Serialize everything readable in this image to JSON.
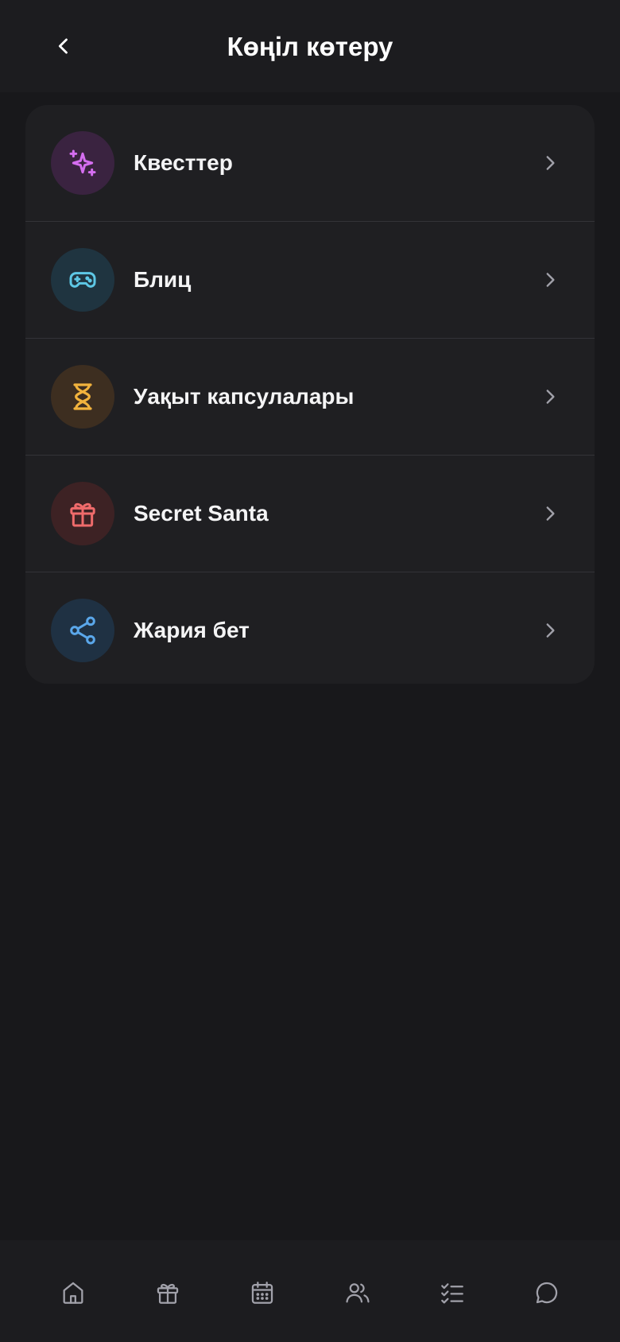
{
  "header": {
    "title": "Көңіл көтеру",
    "back_icon": "chevron-left-icon"
  },
  "menu": {
    "items": [
      {
        "label": "Квесттер",
        "icon": "sparkles-icon",
        "accent": "#d56ef0",
        "bg": "#3a2340"
      },
      {
        "label": "Блиц",
        "icon": "gamepad-icon",
        "accent": "#5ec8e6",
        "bg": "#1f3440"
      },
      {
        "label": "Уақыт капсулалары",
        "icon": "hourglass-icon",
        "accent": "#f2b33d",
        "bg": "#3d2e20"
      },
      {
        "label": "Secret Santa",
        "icon": "gift-icon",
        "accent": "#ef6b6b",
        "bg": "#3d2224"
      },
      {
        "label": "Жария бет",
        "icon": "share-icon",
        "accent": "#5aa7ea",
        "bg": "#1f3143"
      }
    ],
    "chevron_icon": "chevron-right-icon"
  },
  "tabbar": {
    "tabs": [
      {
        "icon": "home-icon"
      },
      {
        "icon": "gift-icon"
      },
      {
        "icon": "calendar-icon"
      },
      {
        "icon": "users-icon"
      },
      {
        "icon": "checklist-icon"
      },
      {
        "icon": "chat-icon"
      }
    ]
  },
  "colors": {
    "background": "#18181b",
    "card": "#1f1f22",
    "header": "#1c1c1f",
    "tab_icon": "#a1a1aa",
    "chevron": "#a1a1aa"
  }
}
